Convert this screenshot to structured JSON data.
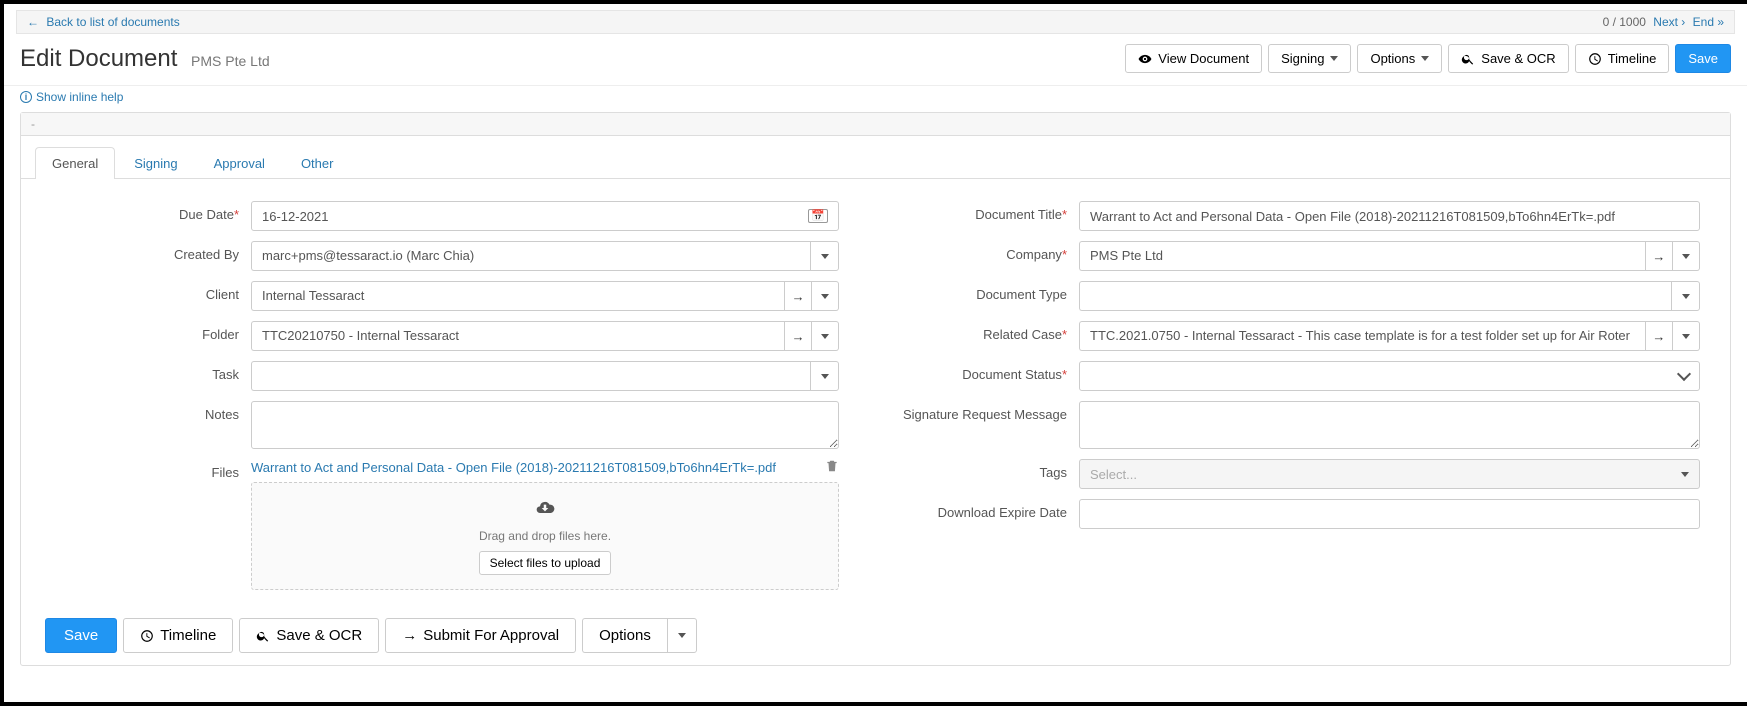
{
  "topbar": {
    "back_label": "Back to list of documents",
    "pager_count": "0 / 1000",
    "next_label": "Next ›",
    "end_label": "End »"
  },
  "header": {
    "title": "Edit Document",
    "subtitle": "PMS Pte Ltd",
    "view_doc": "View Document",
    "signing": "Signing",
    "options": "Options",
    "save_ocr": "Save & OCR",
    "timeline": "Timeline",
    "save": "Save"
  },
  "help_label": "Show inline help",
  "panel_dash": "-",
  "tabs": {
    "general": "General",
    "signing": "Signing",
    "approval": "Approval",
    "other": "Other"
  },
  "labels": {
    "due_date": "Due Date",
    "created_by": "Created By",
    "client": "Client",
    "folder": "Folder",
    "task": "Task",
    "notes": "Notes",
    "files": "Files",
    "doc_title": "Document Title",
    "company": "Company",
    "doc_type": "Document Type",
    "related_case": "Related Case",
    "doc_status": "Document Status",
    "sig_msg": "Signature Request Message",
    "tags": "Tags",
    "dl_expire": "Download Expire Date"
  },
  "values": {
    "due_date": "16-12-2021",
    "created_by": "marc+pms@tessaract.io (Marc Chia)",
    "client": "Internal Tessaract",
    "folder": "TTC20210750 - Internal Tessaract",
    "task": "",
    "notes": "",
    "doc_title": "Warrant to Act and Personal Data - Open File (2018)-20211216T081509,bTo6hn4ErTk=.pdf",
    "company": "PMS Pte Ltd",
    "doc_type": "",
    "related_case": "TTC.2021.0750 - Internal Tessaract - This case template is for a test folder set up for Air Roter",
    "doc_status": "",
    "sig_msg": "",
    "dl_expire": ""
  },
  "files": {
    "file_name": "Warrant to Act and Personal Data - Open File (2018)-20211216T081509,bTo6hn4ErTk=.pdf",
    "dz_text": "Drag and drop files here.",
    "select_btn": "Select files to upload"
  },
  "tags_placeholder": "Select...",
  "bottom": {
    "save": "Save",
    "timeline": "Timeline",
    "save_ocr": "Save & OCR",
    "submit_approval": "Submit For Approval",
    "options": "Options"
  }
}
